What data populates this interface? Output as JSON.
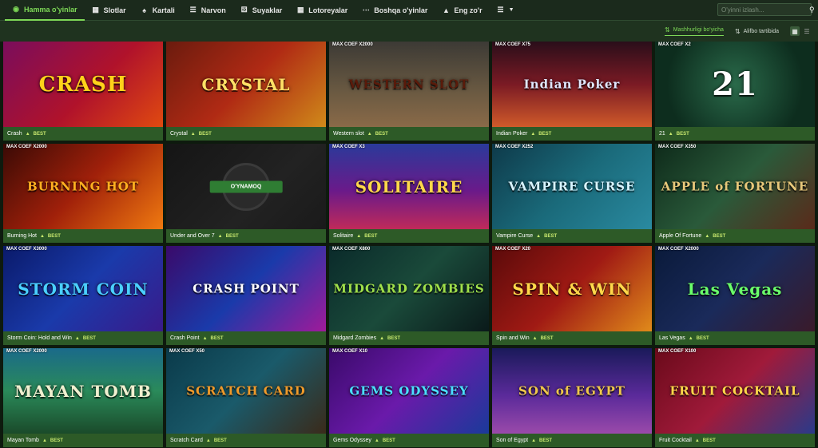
{
  "nav": {
    "items": [
      {
        "label": "Hamma o'yinlar",
        "icon": "gamepad-icon"
      },
      {
        "label": "Slotlar",
        "icon": "slot-icon"
      },
      {
        "label": "Kartali",
        "icon": "spade-icon"
      },
      {
        "label": "Narvon",
        "icon": "ladder-icon"
      },
      {
        "label": "Suyaklar",
        "icon": "dice-icon"
      },
      {
        "label": "Lotoreyalar",
        "icon": "ticket-icon"
      },
      {
        "label": "Boshqa o'yinlar",
        "icon": "dots-icon"
      },
      {
        "label": "Eng zo'r",
        "icon": "flame-icon"
      }
    ],
    "search_placeholder": "O'yinni izlash..."
  },
  "sort": {
    "popular": "Mashhurligi bo'yicha",
    "alpha": "Alifbo tartibida"
  },
  "best_label": "BEST",
  "play_label": "O'YNAMOQ",
  "accent": "#7ed957",
  "games": [
    {
      "name": "Crash",
      "coef": "",
      "logo": "CRASH",
      "bg": "linear-gradient(135deg,#7a0d5c,#b0122b 55%,#e04a10)",
      "logo_color": "#ffd21a"
    },
    {
      "name": "Crystal",
      "coef": "",
      "logo": "CRYSTAL",
      "bg": "linear-gradient(135deg,#6b1b0e,#b02a14 50%,#d08a1a)",
      "logo_color": "#ffe066"
    },
    {
      "name": "Western slot",
      "coef": "MAX COEF X2000",
      "logo": "WESTERN SLOT",
      "bg": "linear-gradient(180deg,#3c3a35,#6b5a42 60%,#8a6a48)",
      "logo_color": "#5a1a0a"
    },
    {
      "name": "Indian Poker",
      "coef": "MAX COEF X75",
      "logo": "Indian Poker",
      "bg": "linear-gradient(180deg,#2a0e1a,#7a1a24 50%,#d05a2a)",
      "logo_color": "#e0e8ff"
    },
    {
      "name": "21",
      "coef": "MAX COEF X2",
      "logo": "21",
      "bg": "radial-gradient(circle at 50% 50%,#2a6a4a,#0d2d1e 75%)",
      "logo_color": "#ffffff"
    },
    {
      "name": "Burning Hot",
      "coef": "MAX COEF X2000",
      "logo": "BURNING HOT",
      "bg": "linear-gradient(135deg,#3a0a05,#a0200a 50%,#f07a10)",
      "logo_color": "#ffb020"
    },
    {
      "name": "Under and Over 7",
      "coef": "",
      "logo": "",
      "bg": "linear-gradient(135deg,#151515,#222 60%,#1a1a1a)",
      "logo_color": "#ffffff"
    },
    {
      "name": "Solitaire",
      "coef": "MAX COEF X3",
      "logo": "SOLITAIRE",
      "bg": "linear-gradient(180deg,#2a3a9a,#6a1a8a 55%,#c02a5a)",
      "logo_color": "#ffd84a"
    },
    {
      "name": "Vampire Curse",
      "coef": "MAX COEF X252",
      "logo": "VAMPIRE CURSE",
      "bg": "linear-gradient(135deg,#0e3a4a,#1a6a7a 50%,#2a8aa0)",
      "logo_color": "#d8f4ff"
    },
    {
      "name": "Apple Of Fortune",
      "coef": "MAX COEF X350",
      "logo": "APPLE of FORTUNE",
      "bg": "linear-gradient(135deg,#0e2a1a,#2a5a3a 50%,#5a2a1a)",
      "logo_color": "#e8c87a"
    },
    {
      "name": "Storm Coin: Hold and Win",
      "coef": "MAX COEF X3000",
      "logo": "STORM COIN",
      "bg": "linear-gradient(135deg,#0a1a6a,#1a3aaa 50%,#3a1a8a)",
      "logo_color": "#4ad0ff"
    },
    {
      "name": "Crash Point",
      "coef": "",
      "logo": "CRASH POINT",
      "bg": "linear-gradient(135deg,#3a0a6a,#1a3aaa 50%,#a01a9a)",
      "logo_color": "#ffffff"
    },
    {
      "name": "Midgard Zombies",
      "coef": "MAX COEF X800",
      "logo": "MIDGARD ZOMBIES",
      "bg": "linear-gradient(135deg,#0a2a2a,#1a4a3a 50%,#0a1a1a)",
      "logo_color": "#a0e04a"
    },
    {
      "name": "Spin and Win",
      "coef": "MAX COEF X20",
      "logo": "SPIN & WIN",
      "bg": "linear-gradient(135deg,#5a0a0a,#a01a14 50%,#e08a1a)",
      "logo_color": "#ffd84a"
    },
    {
      "name": "Las Vegas",
      "coef": "MAX COEF X2000",
      "logo": "Las Vegas",
      "bg": "linear-gradient(135deg,#0a1a3a,#1a2a5a 50%,#3a1a2a)",
      "logo_color": "#6aff6a"
    },
    {
      "name": "Mayan Tomb",
      "coef": "MAX COEF X2000",
      "logo": "MAYAN TOMB",
      "bg": "linear-gradient(180deg,#1a6a8a,#2a8a5a 50%,#1a4a2a)",
      "logo_color": "#f0f0d0"
    },
    {
      "name": "Scratch Card",
      "coef": "MAX COEF X50",
      "logo": "SCRATCH CARD",
      "bg": "linear-gradient(135deg,#0a3a4a,#1a5a6a 50%,#3a2a1a)",
      "logo_color": "#f09a2a"
    },
    {
      "name": "Gems Odyssey",
      "coef": "MAX COEF X10",
      "logo": "GEMS ODYSSEY",
      "bg": "linear-gradient(135deg,#3a0a6a,#6a1aaa 50%,#1a3a9a)",
      "logo_color": "#4ae0ff"
    },
    {
      "name": "Son of Egypt",
      "coef": "",
      "logo": "SON of EGYPT",
      "bg": "linear-gradient(180deg,#1a1a5a,#5a2a9a 55%,#9a4aaa)",
      "logo_color": "#f0c84a"
    },
    {
      "name": "Fruit Cocktail",
      "coef": "MAX COEF X100",
      "logo": "FRUIT COCKTAIL",
      "bg": "linear-gradient(135deg,#6a0a1a,#a01a3a 50%,#2a3a8a)",
      "logo_color": "#ffd84a"
    }
  ]
}
